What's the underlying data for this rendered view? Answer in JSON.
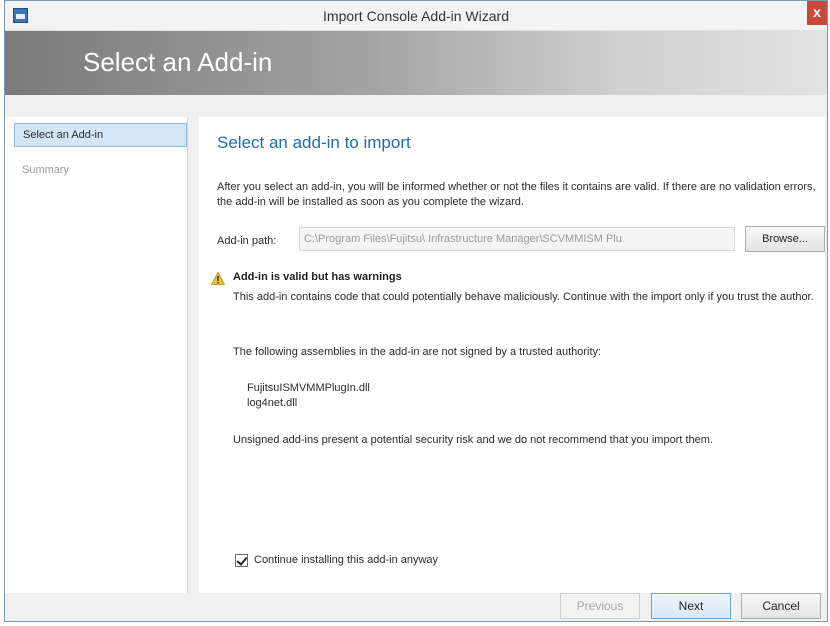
{
  "window": {
    "title": "Import Console Add-in Wizard",
    "close_glyph": "x"
  },
  "banner": {
    "title": "Select an Add-in"
  },
  "nav": {
    "items": [
      {
        "label": "Select an Add-in",
        "active": true
      },
      {
        "label": "Summary",
        "active": false
      }
    ]
  },
  "page": {
    "heading": "Select an add-in to import",
    "intro": "After you select an add-in, you will be informed whether or not the files it contains are valid. If there are no validation errors, the add-in will be installed as soon as you complete the wizard.",
    "path_label": "Add-in path:",
    "path_value": "C:\\Program Files\\Fujitsu\\ Infrastructure Manager\\SCVMMISM Plu",
    "browse_label": "Browse...",
    "warning_title": "Add-in is valid but has warnings",
    "warning_body": "This add-in contains code that could potentially behave maliciously. Continue with the import only if you trust the author.",
    "assembly_intro": "The following assemblies in the add-in are not signed by a trusted authority:",
    "assemblies": [
      "FujitsuISMVMMPlugIn.dll",
      "log4net.dll"
    ],
    "unsigned_note": "Unsigned add-ins present a potential security risk and we do not recommend that you import them.",
    "continue_label": "Continue installing this add-in anyway",
    "continue_checked": true
  },
  "footer": {
    "previous_label": "Previous",
    "next_label": "Next",
    "cancel_label": "Cancel"
  },
  "colors": {
    "heading_blue": "#1f6ab0",
    "nav_active_bg": "#d3e6f8",
    "close_red": "#c84a3a",
    "warning_yellow": "#f2c12e"
  }
}
